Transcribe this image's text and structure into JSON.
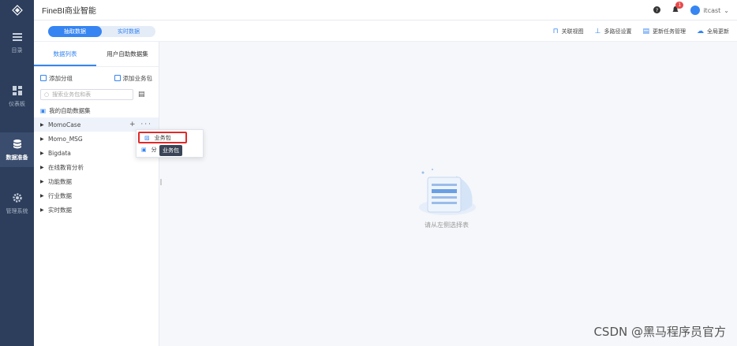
{
  "app": {
    "title": "FineBI商业智能"
  },
  "nav": {
    "items": [
      {
        "label": "目录",
        "icon": "list-icon"
      },
      {
        "label": "仪表板",
        "icon": "dashboard-icon"
      },
      {
        "label": "数据准备",
        "icon": "database-icon",
        "active": true
      },
      {
        "label": "管理系统",
        "icon": "gear-icon"
      }
    ]
  },
  "header": {
    "help_icon": "help-icon",
    "notification_count": "1",
    "user_name": "itcast"
  },
  "toolbar": {
    "segments": [
      "抽取数据",
      "实时数据"
    ],
    "active_segment": "抽取数据",
    "tools": [
      {
        "label": "关联视图",
        "icon": "relation-icon"
      },
      {
        "label": "多路径设置",
        "icon": "path-icon"
      },
      {
        "label": "更新任务管理",
        "icon": "task-icon"
      },
      {
        "label": "全局更新",
        "icon": "cloud-icon"
      }
    ]
  },
  "panel": {
    "tabs": [
      "数据列表",
      "用户自助数据集"
    ],
    "add_group": "添加分组",
    "add_package": "添加业务包",
    "search_placeholder": "搜索业务包和表",
    "mine": "我的自助数据集",
    "tree": [
      "MomoCase",
      "Momo_MSG",
      "Bigdata",
      "在线教育分析",
      "功能数据",
      "行业数据",
      "实时数据"
    ],
    "row_ops": "+ ···"
  },
  "menu": {
    "items": [
      "业务包",
      "分"
    ],
    "tooltip": "业务包"
  },
  "main": {
    "empty_text": "请从左侧选择表"
  },
  "watermark": "CSDN @黑马程序员官方",
  "colors": {
    "accent": "#3685f2",
    "nav_bg": "#2c3e5c",
    "highlight": "#e02a2a"
  }
}
